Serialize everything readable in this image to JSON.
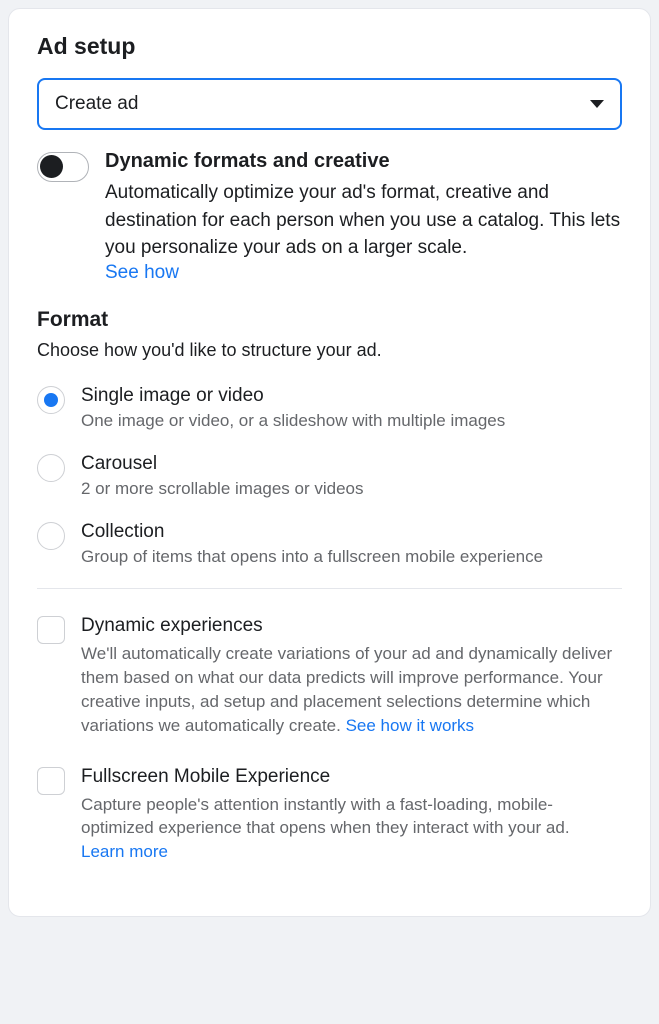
{
  "header": {
    "title": "Ad setup"
  },
  "select": {
    "value": "Create ad"
  },
  "dynamic_creative": {
    "title": "Dynamic formats and creative",
    "description": "Automatically optimize your ad's format, creative and destination for each person when you use a catalog. This lets you personalize your ads on a larger scale.",
    "link": "See how"
  },
  "format": {
    "title": "Format",
    "subtitle": "Choose how you'd like to structure your ad.",
    "options": [
      {
        "title": "Single image or video",
        "description": "One image or video, or a slideshow with multiple images"
      },
      {
        "title": "Carousel",
        "description": "2 or more scrollable images or videos"
      },
      {
        "title": "Collection",
        "description": "Group of items that opens into a fullscreen mobile experience"
      }
    ]
  },
  "dynamic_experiences": {
    "title": "Dynamic experiences",
    "description": "We'll automatically create variations of your ad and dynamically deliver them based on what our data predicts will improve performance. Your creative inputs, ad setup and placement selections determine which variations we automatically create. ",
    "link": "See how it works"
  },
  "fullscreen_mobile": {
    "title": "Fullscreen Mobile Experience",
    "description": "Capture people's attention instantly with a fast-loading, mobile-optimized experience that opens when they interact with your ad.",
    "link": "Learn more"
  }
}
